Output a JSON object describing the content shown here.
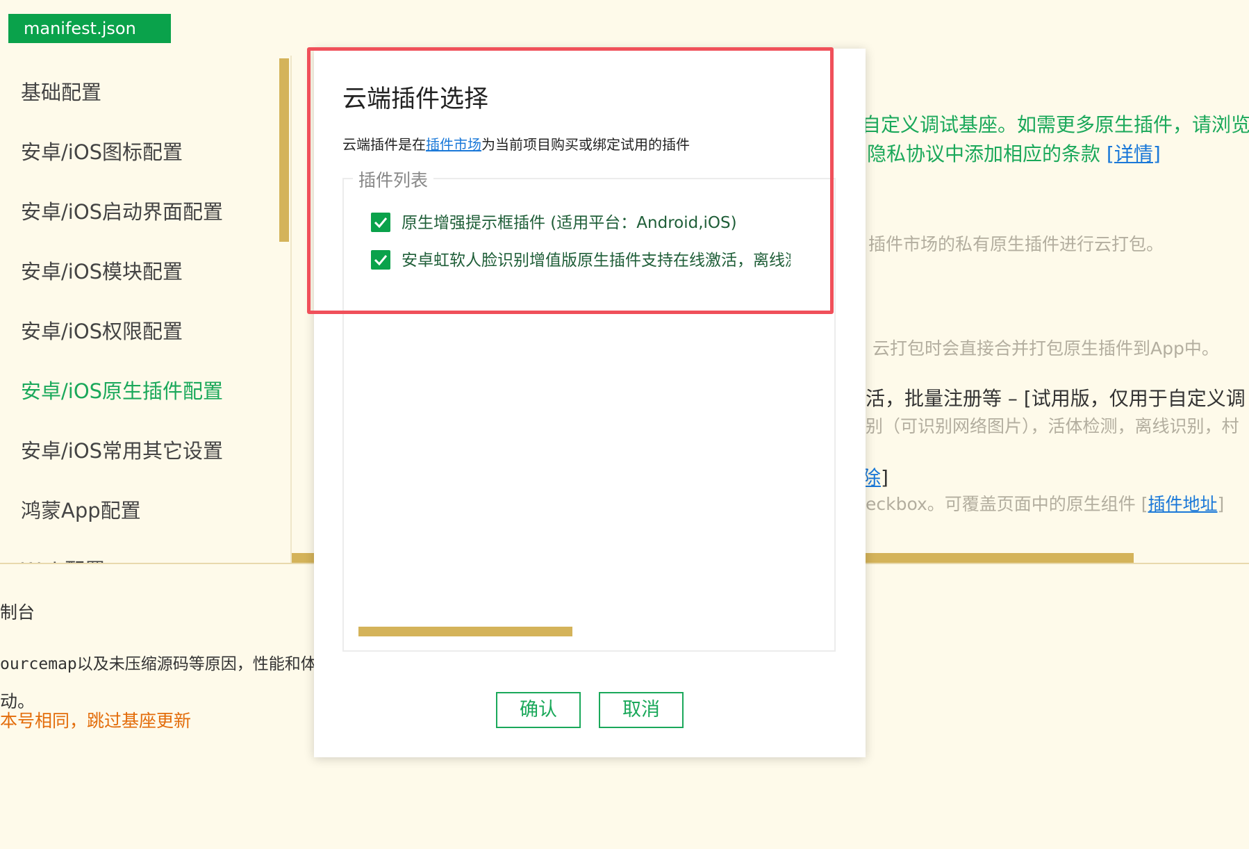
{
  "file_tab": {
    "label": "manifest.json"
  },
  "sidebar": {
    "items": [
      {
        "label": "基础配置",
        "active": false
      },
      {
        "label": "安卓/iOS图标配置",
        "active": false
      },
      {
        "label": "安卓/iOS启动界面配置",
        "active": false
      },
      {
        "label": "安卓/iOS模块配置",
        "active": false
      },
      {
        "label": "安卓/iOS权限配置",
        "active": false
      },
      {
        "label": "安卓/iOS原生插件配置",
        "active": true
      },
      {
        "label": "安卓/iOS常用其它设置",
        "active": false
      },
      {
        "label": "鸿蒙App配置",
        "active": false
      },
      {
        "label": "Web配置",
        "active": false
      }
    ]
  },
  "background_content": {
    "line1": "自定义调试基座。如需更多原生插件，请浏览插",
    "line2_text": "隐私协议中添加相应的条款",
    "line2_link": "[详情]",
    "line3": "插件市场的私有原生插件进行云打包。",
    "line4": "云打包时会直接合并打包原生插件到App中。",
    "line5": "活，批量注册等 – [试用版，仅用于自定义调",
    "line6": "别（可识别网络图片），活体检测，离线识别，村",
    "line7_link": "除",
    "line7_tail": "]",
    "line8_text": "eckbox。可覆盖页面中的原生组件 [",
    "line8_link": "插件地址",
    "line8_tail": "]"
  },
  "console": {
    "title": "制台",
    "line1": "ourcemap以及未压缩源码等原因，性能和体",
    "line2": "动。",
    "line3": "本号相同，跳过基座更新"
  },
  "modal": {
    "title": "云端插件选择",
    "desc_prefix": "云端插件是在",
    "desc_link": "插件市场",
    "desc_suffix": "为当前项目购买或绑定试用的插件",
    "fieldset_legend": "插件列表",
    "plugins": [
      {
        "label": "原生增强提示框插件 (适用平台：Android,iOS)",
        "checked": true
      },
      {
        "label": "安卓虹软人脸识别增值版原生插件支持在线激活，离线激活",
        "checked": true
      }
    ],
    "confirm_label": "确认",
    "cancel_label": "取消"
  },
  "colors": {
    "accent_green": "#0aa24b",
    "link_blue": "#1a78d8",
    "scrollbar_gold": "#d4b35a",
    "highlight_red": "#f0505a",
    "background": "#fefaea"
  }
}
